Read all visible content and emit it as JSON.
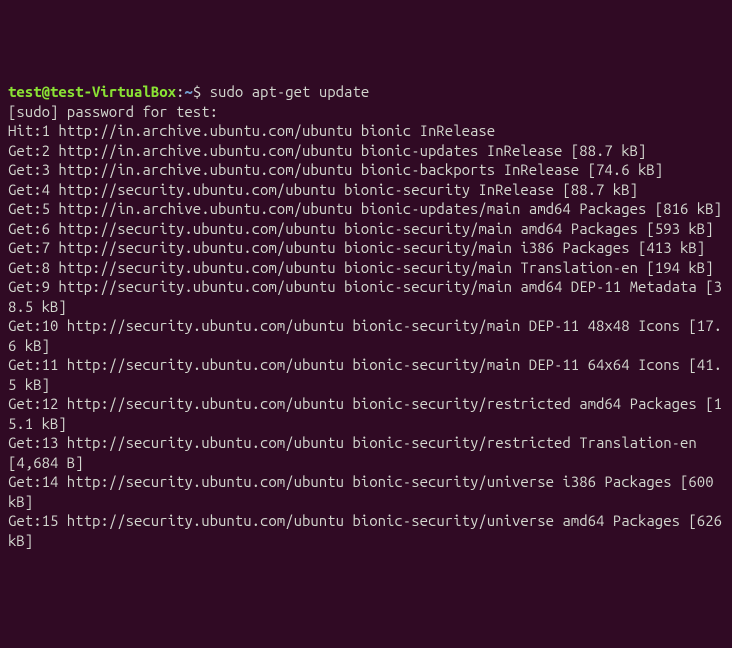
{
  "prompt": {
    "user_host": "test@test-VirtualBox",
    "colon": ":",
    "path": "~",
    "dollar": "$ ",
    "command": "sudo apt-get update"
  },
  "lines": [
    "[sudo] password for test:",
    "Hit:1 http://in.archive.ubuntu.com/ubuntu bionic InRelease",
    "Get:2 http://in.archive.ubuntu.com/ubuntu bionic-updates InRelease [88.7 kB]",
    "Get:3 http://in.archive.ubuntu.com/ubuntu bionic-backports InRelease [74.6 kB]",
    "Get:4 http://security.ubuntu.com/ubuntu bionic-security InRelease [88.7 kB]",
    "Get:5 http://in.archive.ubuntu.com/ubuntu bionic-updates/main amd64 Packages [816 kB]",
    "Get:6 http://security.ubuntu.com/ubuntu bionic-security/main amd64 Packages [593 kB]",
    "Get:7 http://security.ubuntu.com/ubuntu bionic-security/main i386 Packages [413 kB]",
    "Get:8 http://security.ubuntu.com/ubuntu bionic-security/main Translation-en [194 kB]",
    "Get:9 http://security.ubuntu.com/ubuntu bionic-security/main amd64 DEP-11 Metadata [38.5 kB]",
    "Get:10 http://security.ubuntu.com/ubuntu bionic-security/main DEP-11 48x48 Icons [17.6 kB]",
    "Get:11 http://security.ubuntu.com/ubuntu bionic-security/main DEP-11 64x64 Icons [41.5 kB]",
    "Get:12 http://security.ubuntu.com/ubuntu bionic-security/restricted amd64 Packages [15.1 kB]",
    "Get:13 http://security.ubuntu.com/ubuntu bionic-security/restricted Translation-en [4,684 B]",
    "Get:14 http://security.ubuntu.com/ubuntu bionic-security/universe i386 Packages [600 kB]",
    "Get:15 http://security.ubuntu.com/ubuntu bionic-security/universe amd64 Packages [626 kB]"
  ]
}
